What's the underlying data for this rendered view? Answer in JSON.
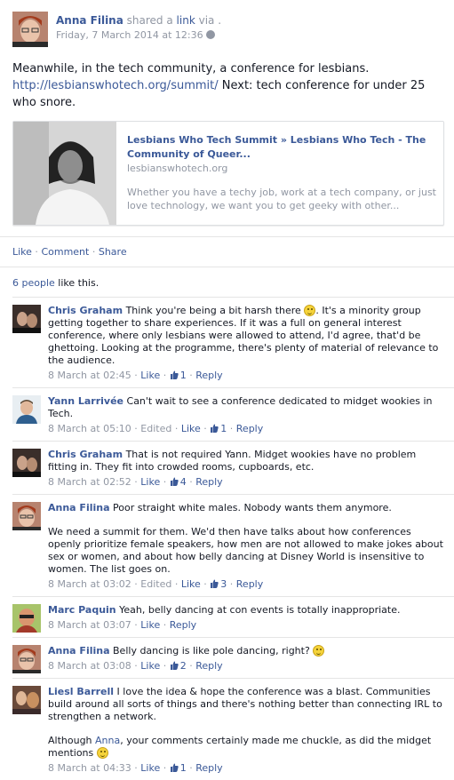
{
  "post": {
    "author": "Anna Filina",
    "shared_text_1": "shared a",
    "shared_link_word": "link",
    "shared_text_2": "via .",
    "date": "Friday, 7 March 2014 at 12:36",
    "message_line1": "Meanwhile, in the tech community, a conference for lesbians.",
    "message_url": "http://lesbianswhotech.org/summit/",
    "message_rest": " Next: tech conference for under 25 who snore."
  },
  "card": {
    "title": "Lesbians Who Tech Summit » Lesbians Who Tech - The Community of Queer...",
    "domain": "lesbianswhotech.org",
    "description": "Whether you have a techy job, work at a tech company, or just love technology, we want you to get geeky with other..."
  },
  "actions": {
    "like": "Like",
    "comment": "Comment",
    "share": "Share",
    "sep": " · "
  },
  "likes": {
    "count_link": "6 people",
    "rest": " like this."
  },
  "comments": [
    {
      "name": "Chris Graham",
      "text_a": " Think you're being a bit harsh there ",
      "text_b": ". It's a minority group getting together to share experiences. If it was a full on general interest conference, where only lesbians were allowed to attend, I'd agree, that'd be ghettoing. Looking at the programme, there's plenty of material of relevance to the audience.",
      "time": "8 March at 02:45",
      "like": "Like",
      "likes": "1",
      "reply": "Reply"
    },
    {
      "name": "Yann Larrivée",
      "text_a": " Can't wait to see a conference dedicated to midget wookies in Tech.",
      "time": "8 March at 05:10",
      "edited": "Edited",
      "like": "Like",
      "likes": "1",
      "reply": "Reply"
    },
    {
      "name": "Chris Graham",
      "text_a": " That is not required Yann. Midget wookies have no problem fitting in. They fit into crowded rooms, cupboards, etc.",
      "time": "8 March at 02:52",
      "like": "Like",
      "likes": "4",
      "reply": "Reply"
    },
    {
      "name": "Anna Filina",
      "text_a": " Poor straight white males. Nobody wants them anymore.",
      "text_p2": "We need a summit for them. We'd then have talks about how conferences openly prioritize female speakers, how men are not allowed to make jokes about sex or women, and about how belly dancing at Disney World is insensitive to women. The list goes on.",
      "time": "8 March at 03:02",
      "edited": "Edited",
      "like": "Like",
      "likes": "3",
      "reply": "Reply"
    },
    {
      "name": "Marc Paquin",
      "text_a": " Yeah, belly dancing at con events is totally inappropriate.",
      "time": "8 March at 03:07",
      "like": "Like",
      "reply": "Reply"
    },
    {
      "name": "Anna Filina",
      "text_a": " Belly dancing is like pole dancing, right? ",
      "time": "8 March at 03:08",
      "like": "Like",
      "likes": "2",
      "reply": "Reply"
    },
    {
      "name": "Liesl Barrell",
      "text_a": " I love the idea & hope the conference was a blast. Communities build around all sorts of things and there's nothing better than connecting IRL to strengthen a network.",
      "text_p2_a": "Although ",
      "text_p2_link": "Anna",
      "text_p2_b": ", your comments certainly made me chuckle, as did the midget mentions ",
      "time": "8 March at 04:33",
      "like": "Like",
      "likes": "1",
      "reply": "Reply"
    }
  ],
  "colors": {
    "link": "#3b5998",
    "meta": "#9197a3",
    "text": "#141823"
  }
}
